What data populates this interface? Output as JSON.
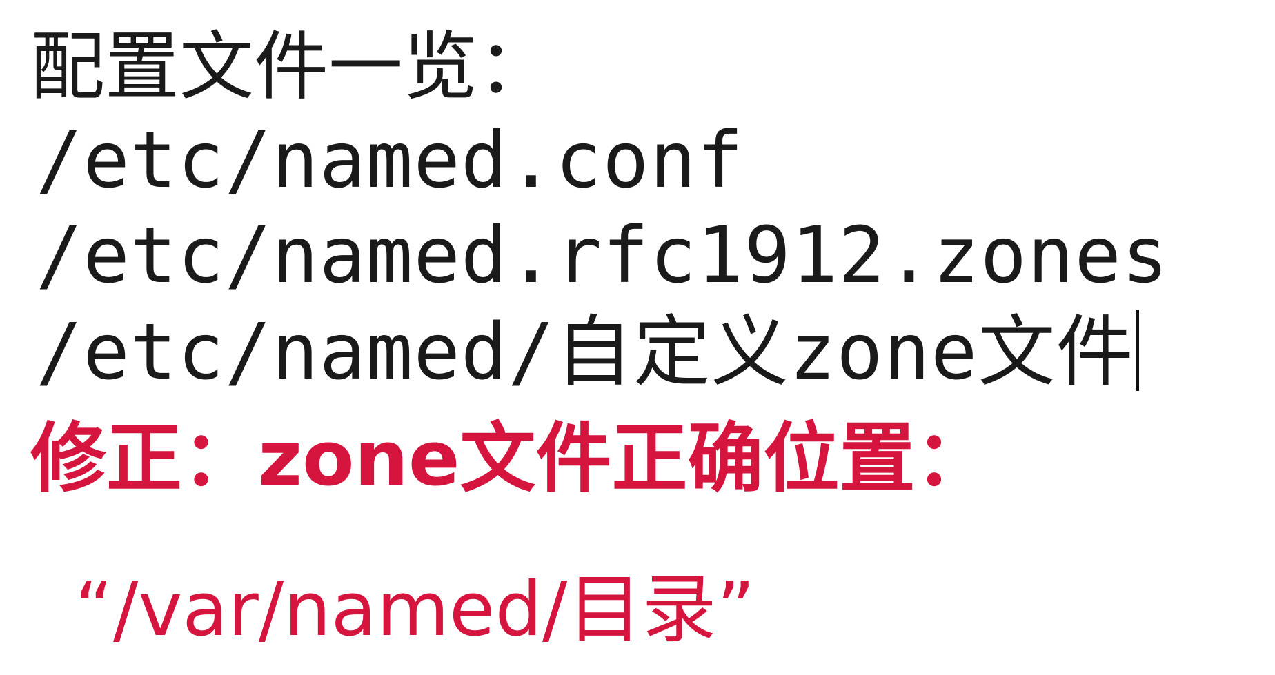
{
  "document": {
    "heading": "配置文件一览：",
    "files": [
      {
        "path_prefix": "/etc/named.conf",
        "path_suffix_cjk": "",
        "path_tail": "",
        "path_tail_cjk": ""
      },
      {
        "path_prefix": "/etc/named.rfc1912.zones",
        "path_suffix_cjk": "",
        "path_tail": "",
        "path_tail_cjk": ""
      },
      {
        "path_prefix": "/etc/named/",
        "path_suffix_cjk": "自定义",
        "path_tail": "zone",
        "path_tail_cjk": "文件"
      }
    ],
    "correction": {
      "label": "修正：zone文件正确位置：",
      "location": "“/var/named/目录”"
    },
    "colors": {
      "text": "#1a1a1a",
      "correction": "#d6153e"
    }
  }
}
